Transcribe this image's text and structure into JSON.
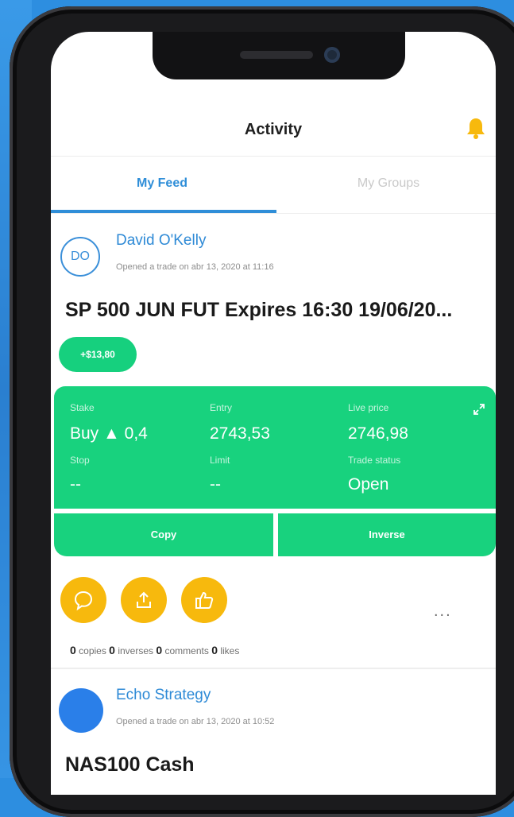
{
  "colors": {
    "accent_blue": "#2f8ed8",
    "trade_green": "#18d27e",
    "action_yellow": "#f7b90d",
    "inactive_tab": "#c9c9c9"
  },
  "header": {
    "title": "Activity",
    "bell_icon": "bell-icon"
  },
  "tabs": [
    {
      "label": "My Feed",
      "active": true
    },
    {
      "label": "My Groups",
      "active": false
    }
  ],
  "feed": [
    {
      "avatar_initials": "DO",
      "author": "David O'Kelly",
      "meta": "Opened a trade on abr 13, 2020 at 11:16",
      "instrument": "SP 500 JUN FUT Expires 16:30 19/06/20...",
      "pnl": "+$13,80",
      "trade": {
        "stake_label": "Stake",
        "stake_value": "Buy ▲ 0,4",
        "entry_label": "Entry",
        "entry_value": "2743,53",
        "live_label": "Live price",
        "live_value": "2746,98",
        "stop_label": "Stop",
        "stop_value": "--",
        "limit_label": "Limit",
        "limit_value": "--",
        "status_label": "Trade status",
        "status_value": "Open"
      },
      "copy_label": "Copy",
      "inverse_label": "Inverse",
      "actions": [
        "comment-icon",
        "share-icon",
        "like-icon"
      ],
      "more": "...",
      "stats": {
        "copies_count": "0",
        "copies_label": "copies",
        "inverses_count": "0",
        "inverses_label": "inverses",
        "comments_count": "0",
        "comments_label": "comments",
        "likes_count": "0",
        "likes_label": "likes"
      }
    },
    {
      "author": "Echo Strategy",
      "meta": "Opened a trade on abr 13, 2020 at 10:52",
      "instrument": "NAS100 Cash"
    }
  ]
}
